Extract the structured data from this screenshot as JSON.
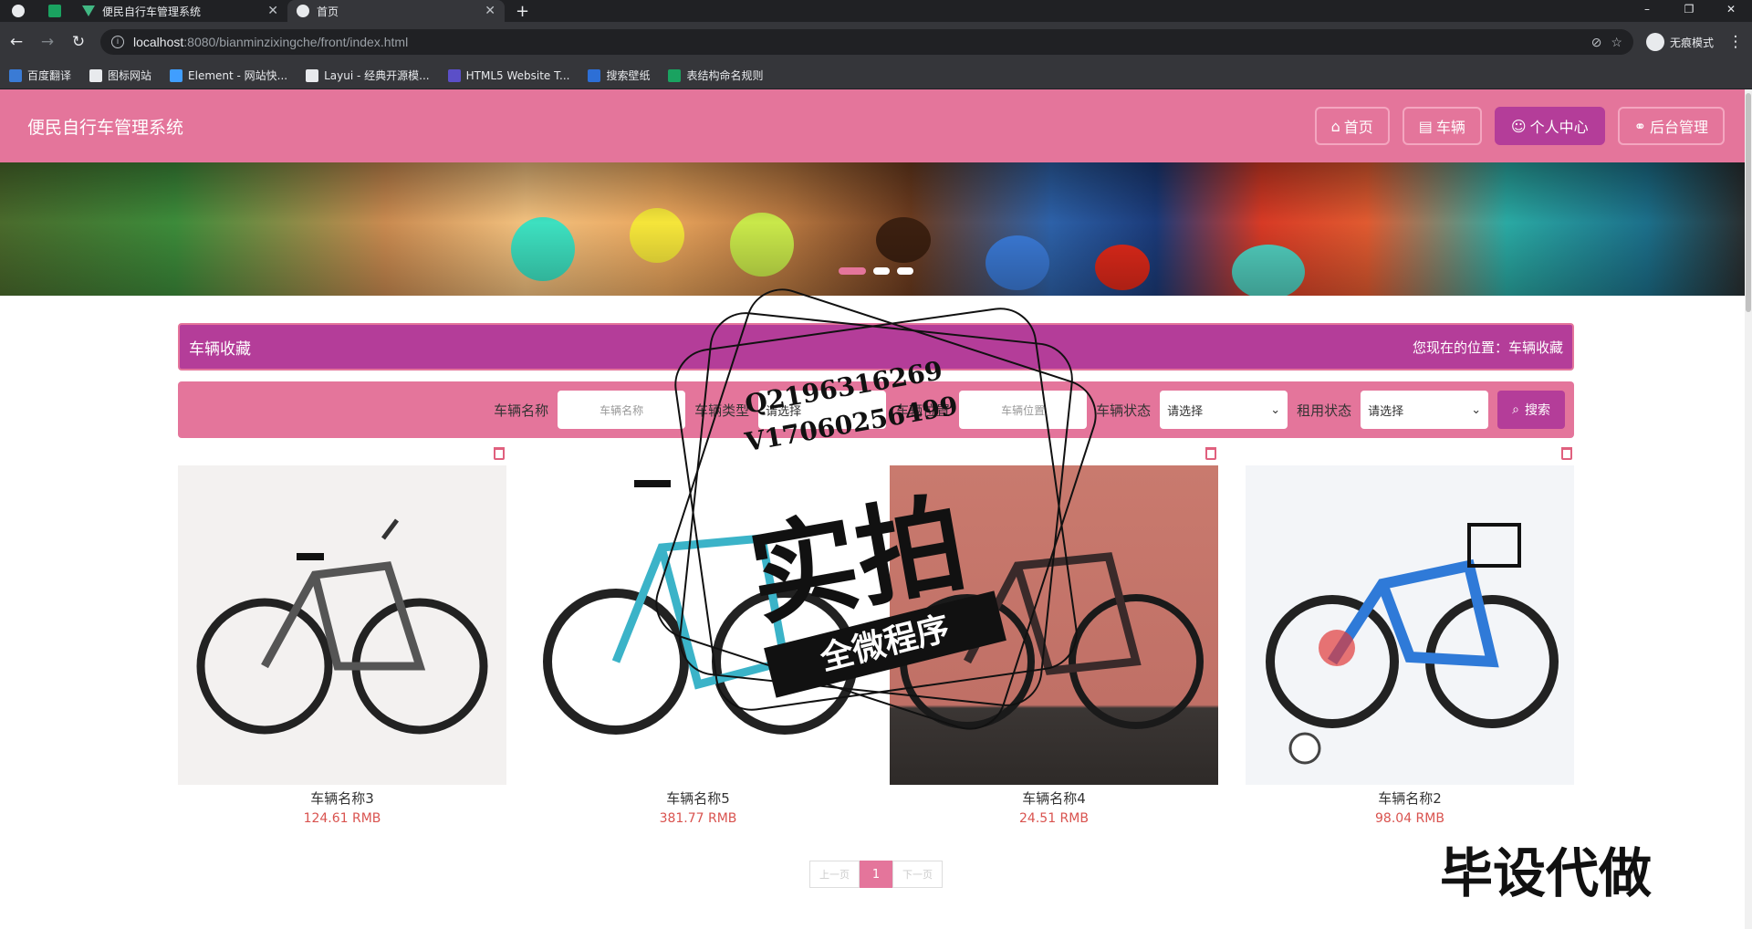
{
  "browser": {
    "tabs": [
      {
        "label": ""
      },
      {
        "label": ""
      },
      {
        "label": "便民自行车管理系统"
      },
      {
        "label": "首页"
      }
    ],
    "url_host": "localhost",
    "url_path": ":8080/bianminzixingche/front/index.html",
    "incognito_label": "无痕模式",
    "bookmarks": [
      {
        "label": "百度翻译",
        "color": "#3a7bd5"
      },
      {
        "label": "图标网站",
        "color": "#e8eaed"
      },
      {
        "label": "Element - 网站快...",
        "color": "#409eff"
      },
      {
        "label": "Layui - 经典开源模...",
        "color": "#e8eaed"
      },
      {
        "label": "HTML5 Website T...",
        "color": "#5b4fc8"
      },
      {
        "label": "搜索壁纸",
        "color": "#2d6fd6"
      },
      {
        "label": "表结构命名规则",
        "color": "#1aa260"
      }
    ]
  },
  "site": {
    "title": "便民自行车管理系统",
    "nav": [
      {
        "icon": "home-icon",
        "label": "首页"
      },
      {
        "icon": "vehicle-icon",
        "label": "车辆"
      },
      {
        "icon": "user-icon",
        "label": "个人中心"
      },
      {
        "icon": "link-icon",
        "label": "后台管理"
      }
    ]
  },
  "crumb": {
    "title": "车辆收藏",
    "location": "您现在的位置：车辆收藏"
  },
  "search": {
    "name_label": "车辆名称",
    "name_placeholder": "车辆名称",
    "type_label": "车辆类型",
    "type_value": "请选择",
    "position_label": "车辆位置",
    "position_placeholder": "车辆位置",
    "status_label": "车辆状态",
    "status_value": "请选择",
    "rent_label": "租用状态",
    "rent_value": "请选择",
    "button": "搜索"
  },
  "items": [
    {
      "name": "车辆名称3",
      "price": "124.61 RMB"
    },
    {
      "name": "车辆名称5",
      "price": "381.77 RMB"
    },
    {
      "name": "车辆名称4",
      "price": "24.51 RMB"
    },
    {
      "name": "车辆名称2",
      "price": "98.04 RMB"
    }
  ],
  "pager": {
    "prev": "上一页",
    "current": "1",
    "next": "下一页"
  },
  "watermark": {
    "q": "Q2196316269",
    "v": "V17060256499",
    "big": "实拍",
    "ribbon": "全微程序",
    "corner": "毕设代做"
  }
}
